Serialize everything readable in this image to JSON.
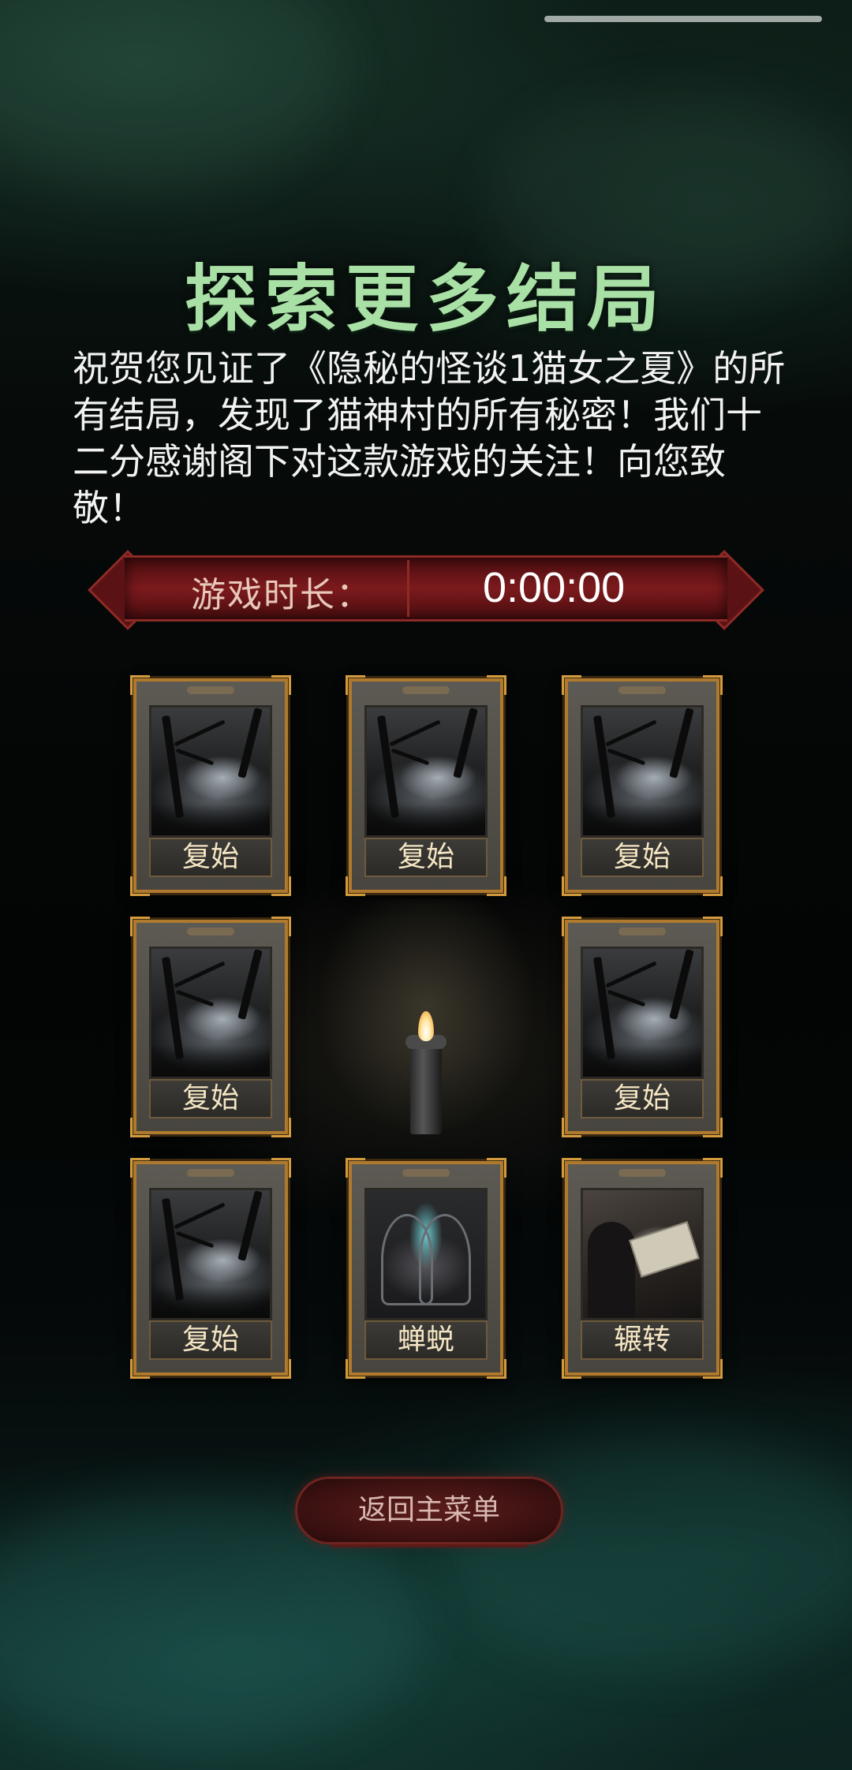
{
  "title": "探索更多结局",
  "message": "祝贺您见证了《隐秘的怪谈1猫女之夏》的所有结局，发现了猫神村的所有秘密！我们十二分感谢阁下对这款游戏的关注！向您致敬！",
  "play_time": {
    "label": "游戏时长：",
    "value": "0:00:00"
  },
  "endings": [
    {
      "name": "复始",
      "art": "forest"
    },
    {
      "name": "复始",
      "art": "forest"
    },
    {
      "name": "复始",
      "art": "forest"
    },
    {
      "name": "复始",
      "art": "forest"
    },
    {
      "name": "复始",
      "art": "forest"
    },
    {
      "name": "复始",
      "art": "forest"
    },
    {
      "name": "蝉蜕",
      "art": "shrine"
    },
    {
      "name": "辗转",
      "art": "desk"
    }
  ],
  "back_button": "返回主菜单",
  "colors": {
    "title": "#a9e0a6",
    "banner": "#7c1a1d",
    "card_frame": "#b07a2e",
    "button": "#5c1d1c"
  }
}
